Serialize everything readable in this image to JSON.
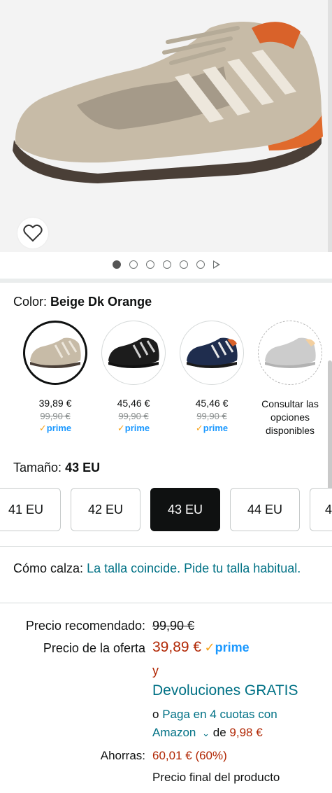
{
  "product": {
    "image_alt": "Geox Snake sneaker beige",
    "carousel": {
      "total_dots": 6,
      "active_index": 0,
      "has_video": true
    }
  },
  "color": {
    "label": "Color:",
    "selected": "Beige Dk Orange",
    "options": [
      {
        "price": "39,89 €",
        "list_price": "99,90 €",
        "prime": "prime",
        "selected": true
      },
      {
        "price": "45,46 €",
        "list_price": "99,90 €",
        "prime": "prime",
        "selected": false
      },
      {
        "price": "45,46 €",
        "list_price": "99,90 €",
        "prime": "prime",
        "selected": false
      },
      {
        "info_line1": "Consultar las",
        "info_line2": "opciones",
        "info_line3": "disponibles"
      }
    ]
  },
  "size": {
    "label": "Tamaño:",
    "selected": "43 EU",
    "options": [
      "41 EU",
      "42 EU",
      "43 EU",
      "44 EU",
      "4"
    ]
  },
  "fit": {
    "label": "Cómo calza:",
    "text": "La talla coincide. Pide tu talla habitual."
  },
  "pricing": {
    "recommended_label": "Precio recomendado:",
    "recommended_value": "99,90 €",
    "offer_label": "Precio de la oferta",
    "offer_value": "39,89 €",
    "prime": "prime",
    "and": "y",
    "returns": "Devoluciones GRATIS",
    "installments_prefix": "o",
    "installments_link": "Paga en 4 cuotas con",
    "installments_link2": "Amazon",
    "installments_of": "de",
    "installments_amount": "9,98 €",
    "savings_label": "Ahorras:",
    "savings_value": "60,01 € (60%)",
    "final_price_note": "Precio final del producto"
  },
  "colors": {
    "teal_link": "#007185",
    "deal_red": "#b12704",
    "prime_blue": "#1a98ff",
    "prime_check": "#f7a31c"
  }
}
